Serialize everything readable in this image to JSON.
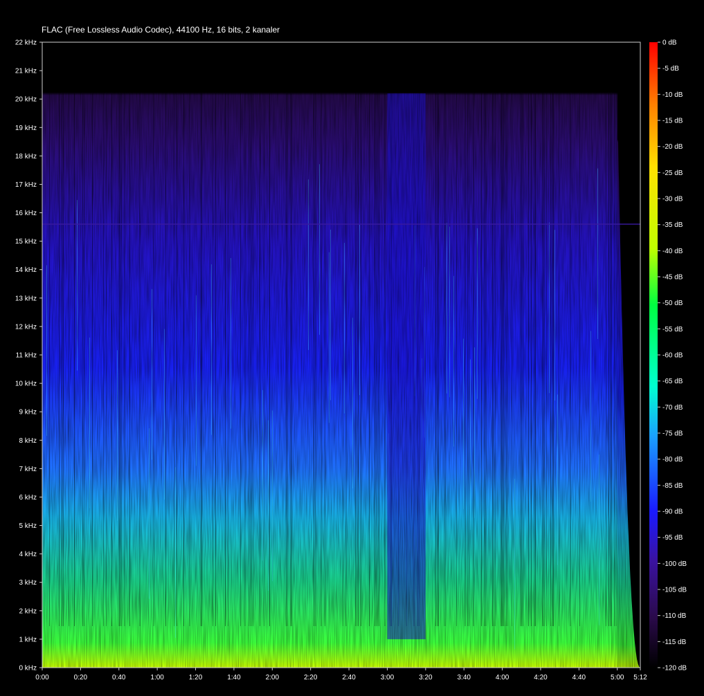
{
  "chart_data": {
    "type": "heatmap",
    "title": "FLAC (Free Lossless Audio Codec), 44100 Hz, 16 bits, 2 kanaler",
    "y_ticks": [
      "0 kHz",
      "1 kHz",
      "2 kHz",
      "3 kHz",
      "4 kHz",
      "5 kHz",
      "6 kHz",
      "7 kHz",
      "8 kHz",
      "9 kHz",
      "10 kHz",
      "11 kHz",
      "12 kHz",
      "13 kHz",
      "14 kHz",
      "15 kHz",
      "16 kHz",
      "17 kHz",
      "18 kHz",
      "19 kHz",
      "20 kHz",
      "21 kHz",
      "22 kHz"
    ],
    "x_ticks": [
      "0:00",
      "0:20",
      "0:40",
      "1:00",
      "1:20",
      "1:40",
      "2:00",
      "2:20",
      "2:40",
      "3:00",
      "3:20",
      "3:40",
      "4:00",
      "4:20",
      "4:40",
      "5:00",
      "5:12"
    ],
    "x_tick_seconds": [
      0,
      20,
      40,
      60,
      80,
      100,
      120,
      140,
      160,
      180,
      200,
      220,
      240,
      260,
      280,
      300,
      312
    ],
    "colorbar_ticks": [
      "0 dB",
      "-5 dB",
      "-10 dB",
      "-15 dB",
      "-20 dB",
      "-25 dB",
      "-30 dB",
      "-35 dB",
      "-40 dB",
      "-45 dB",
      "-50 dB",
      "-55 dB",
      "-60 dB",
      "-65 dB",
      "-70 dB",
      "-75 dB",
      "-80 dB",
      "-85 dB",
      "-90 dB",
      "-95 dB",
      "-100 dB",
      "-105 dB",
      "-110 dB",
      "-115 dB",
      "-120 dB"
    ],
    "xlim_seconds": [
      0,
      312
    ],
    "ylim_khz": [
      0,
      22
    ],
    "zlim_db": [
      -120,
      0
    ],
    "content_cutoff_khz": 20.2,
    "quiet_section_seconds": [
      180,
      200
    ],
    "fade_out_start_seconds": 300,
    "colormap": [
      "#000000",
      "#2a0a4a",
      "#3a12a0",
      "#1a1aff",
      "#1aa0ff",
      "#00ffd0",
      "#00ff40",
      "#c0ff00",
      "#ffe000",
      "#ff8000",
      "#ff0000"
    ]
  }
}
